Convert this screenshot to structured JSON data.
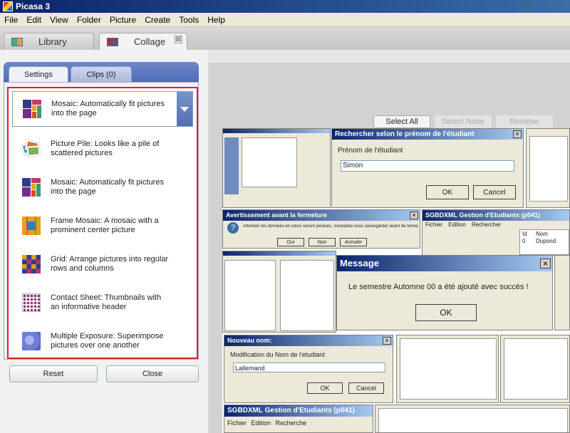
{
  "window": {
    "title": "Picasa 3"
  },
  "menu": [
    "File",
    "Edit",
    "View",
    "Folder",
    "Picture",
    "Create",
    "Tools",
    "Help"
  ],
  "main_tabs": {
    "library": "Library",
    "collage": "Collage",
    "close_glyph": "⊠"
  },
  "panel_tabs": {
    "settings": "Settings",
    "clips": "Clips (0)"
  },
  "collage_type": {
    "selected": "Mosaic:  Automatically fit pictures into the page",
    "options": [
      {
        "icon": "picture-pile-icon",
        "label": "Picture Pile:  Looks like a pile of scattered pictures"
      },
      {
        "icon": "mosaic-icon",
        "label": "Mosaic:  Automatically fit pictures into the page"
      },
      {
        "icon": "frame-mosaic-icon",
        "label": "Frame Mosaic: A mosaic with a prominent center picture"
      },
      {
        "icon": "grid-icon",
        "label": "Grid:  Arrange pictures into regular rows and columns"
      },
      {
        "icon": "contact-sheet-icon",
        "label": "Contact Sheet:  Thumbnails with an informative header"
      },
      {
        "icon": "multiple-exposure-icon",
        "label": "Multiple Exposure:  Superimpose pictures over one another"
      }
    ]
  },
  "bottom_buttons": {
    "reset": "Reset",
    "close": "Close"
  },
  "selection_bar": {
    "select_all": "Select All",
    "select_none": "Select None",
    "remove": "Remove"
  },
  "collage": {
    "search_dialog": {
      "title": "Rechercher selon le prénom de l'étudiant",
      "label": "Prénom de l'étudiant",
      "value": "Simon",
      "ok": "OK",
      "cancel": "Cancel"
    },
    "warning_dialog": {
      "title": "Avertissement avant la fermeture",
      "text": "Attention les données en cours seront perdues, Souhaitez-vous sauvegarder avant de fermer ?",
      "yes": "Oui",
      "no": "Non",
      "cancel": "Annuler"
    },
    "gestion_window": {
      "title": "SGBDXML Gestion d'Etudiants (p041)",
      "menu": [
        "Fichier",
        "Edition",
        "Rechercher"
      ],
      "col_id": "Id",
      "col_nom": "Nom",
      "row_id": "0",
      "row_nom": "Dupond"
    },
    "message_dialog": {
      "title": "Message",
      "text": "Le semestre  Automne 00 a été ajouté avec succès !",
      "ok": "OK"
    },
    "rename_dialog": {
      "title": "Nouveau nom:",
      "label": "Modification du Nom de l'etudiant",
      "value": "Lallemand",
      "ok": "OK",
      "cancel": "Cancel"
    },
    "bottom_window": {
      "title": "SGBDXML Gestion d'Etudiants (p041)",
      "menu": [
        "Fichier",
        "Edition",
        "Recherche"
      ]
    }
  }
}
